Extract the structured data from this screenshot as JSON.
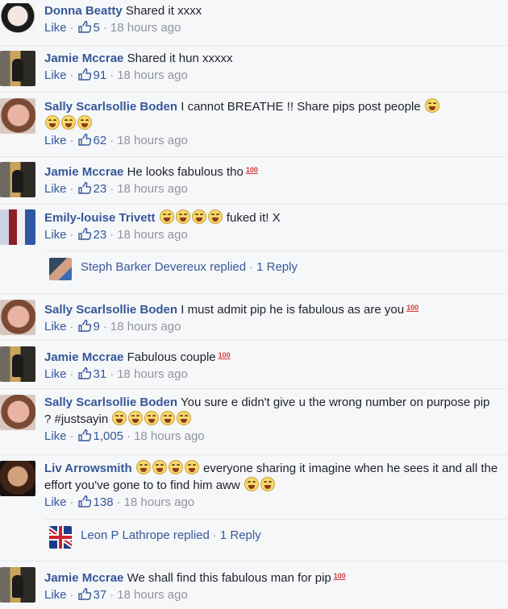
{
  "ui": {
    "like_label": "Like",
    "dot": "·",
    "hundred": "100"
  },
  "comments": [
    {
      "author": "Donna Beatty",
      "text": "Shared it xxxx",
      "likes": "5",
      "time": "18 hours ago",
      "avatar": "av-donna",
      "emoji_after": 0
    },
    {
      "author": "Jamie Mccrae",
      "text": "Shared it hun xxxxx",
      "likes": "91",
      "time": "18 hours ago",
      "avatar": "av-jamie",
      "emoji_after": 0
    },
    {
      "author": "Sally Scarlsollie Boden",
      "text": "I cannot BREATHE !! Share pips post people",
      "likes": "62",
      "time": "18 hours ago",
      "avatar": "av-sally",
      "emoji_after": 4
    },
    {
      "author": "Jamie Mccrae",
      "text": "He looks fabulous tho",
      "likes": "23",
      "time": "18 hours ago",
      "avatar": "av-jamie",
      "hundred": true
    },
    {
      "author": "Emily-louise Trivett",
      "text": "fuked it! X",
      "likes": "23",
      "time": "18 hours ago",
      "avatar": "av-emily",
      "emoji_before": 4
    },
    {
      "author": "Sally Scarlsollie Boden",
      "text": "I must admit pip he is fabulous as are you",
      "likes": "9",
      "time": "18 hours ago",
      "avatar": "av-sally",
      "hundred": true
    },
    {
      "author": "Jamie Mccrae",
      "text": "Fabulous couple",
      "likes": "31",
      "time": "18 hours ago",
      "avatar": "av-jamie",
      "hundred": true
    },
    {
      "author": "Sally Scarlsollie Boden",
      "text": "You sure e didn't give u the wrong number on purpose pip ? #justsayin",
      "likes": "1,005",
      "time": "18 hours ago",
      "avatar": "av-sally",
      "emoji_after": 5
    },
    {
      "author": "Liv Arrowsmith",
      "text": "everyone sharing it imagine when he sees it and all the effort you've gone to to find him aww",
      "likes": "138",
      "time": "18 hours ago",
      "avatar": "av-liv",
      "emoji_before": 4,
      "emoji_after": 2
    },
    {
      "author": "Jamie Mccrae",
      "text": "We shall find this fabulous man for pip",
      "likes": "37",
      "time": "18 hours ago",
      "avatar": "av-jamie",
      "hundred": true
    }
  ],
  "replies": [
    {
      "name": "Steph Barker Devereux replied",
      "count": "1 Reply",
      "avatar": "av-steph"
    },
    {
      "name": "Leon P Lathrope replied",
      "count": "1 Reply",
      "avatar": "av-leon"
    }
  ]
}
